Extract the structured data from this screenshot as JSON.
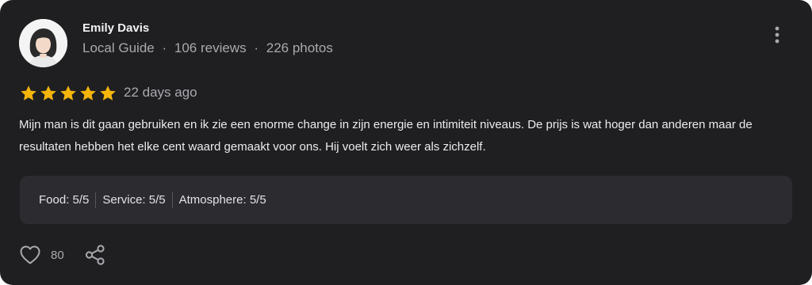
{
  "review": {
    "author": "Emily Davis",
    "author_meta": {
      "badge": "Local Guide",
      "reviews": "106 reviews",
      "photos": "226 photos",
      "separator": "·"
    },
    "stars": 5,
    "max_stars": 5,
    "date": "22 days ago",
    "text": "Mijn man is dit gaan gebruiken en ik zie een enorme change in zijn energie en intimiteit niveaus. De prijs is wat hoger dan anderen maar de resultaten hebben het elke cent waard gemaakt voor ons. Hij voelt zich weer als zichzelf.",
    "ratings": [
      {
        "label": "Food: 5/5"
      },
      {
        "label": "Service: 5/5"
      },
      {
        "label": "Atmosphere: 5/5"
      }
    ],
    "likes": "80"
  },
  "icons": {
    "more": "more-vertical-icon",
    "star": "star-icon",
    "like": "heart-icon",
    "share": "share-icon"
  },
  "colors": {
    "card_bg": "#1f1f22",
    "panel_bg": "#2c2c30",
    "star": "#f5b50a",
    "muted_text": "#a9a9ae"
  }
}
